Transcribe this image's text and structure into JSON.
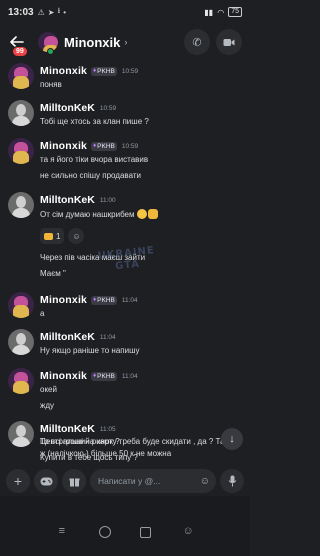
{
  "statusbar": {
    "time": "13:03",
    "battery": "75"
  },
  "header": {
    "unread_badge": "99",
    "title": "Minonxik",
    "chevron": "›"
  },
  "messages": [
    {
      "author": "Minonxik",
      "tag": "PKHB",
      "time": "10:59",
      "lines": [
        "поняв"
      ]
    },
    {
      "author": "MilltonKeK",
      "time": "10:59",
      "lines": [
        "Тобі ще хтось за клан пише ?"
      ]
    },
    {
      "author": "Minonxik",
      "tag": "PKHB",
      "time": "10:59",
      "lines": [
        "та я його тіки вчора виставив",
        "не сильно спішу продавати"
      ]
    },
    {
      "author": "MilltonKeK",
      "time": "11:00",
      "lines": [
        "От сім думаю нашкрибем"
      ],
      "reaction_count": "1",
      "extra_lines": [
        "Через пів часіка маєш зайти",
        "Маєм \""
      ]
    },
    {
      "author": "Minonxik",
      "tag": "PKHB",
      "time": "11:04",
      "lines": [
        "а"
      ]
    },
    {
      "author": "MilltonKeK",
      "time": "11:04",
      "lines": [
        "Ну якщо раніше то напишу"
      ]
    },
    {
      "author": "Minonxik",
      "tag": "PKHB",
      "time": "11:04",
      "lines": [
        "окей",
        "жду"
      ]
    },
    {
      "author": "MilltonKeK",
      "time": "11:05",
      "lines": [
        "То всі гроші на карту треба буде скидати , да ? Там",
        "ж (налічкою ) більше 50 к не можна",
        "Центральний ринок ?",
        "Купити в тебе щось типу ?"
      ]
    }
  ],
  "watermark": {
    "line1": "UKRAINE",
    "line2": "GTA"
  },
  "composer": {
    "placeholder": "Написати у @..."
  },
  "icons": {
    "back": "arrow-left-icon",
    "call": "phone-icon",
    "video": "video-icon",
    "add": "plus-icon",
    "games": "gamepad-icon",
    "gift": "gift-icon",
    "emoji": "smiley-icon",
    "mic": "microphone-icon",
    "scroll": "arrow-down-icon"
  },
  "colors": {
    "background": "#1e1f22",
    "online": "#23a55a",
    "badge": "#ed4245"
  }
}
